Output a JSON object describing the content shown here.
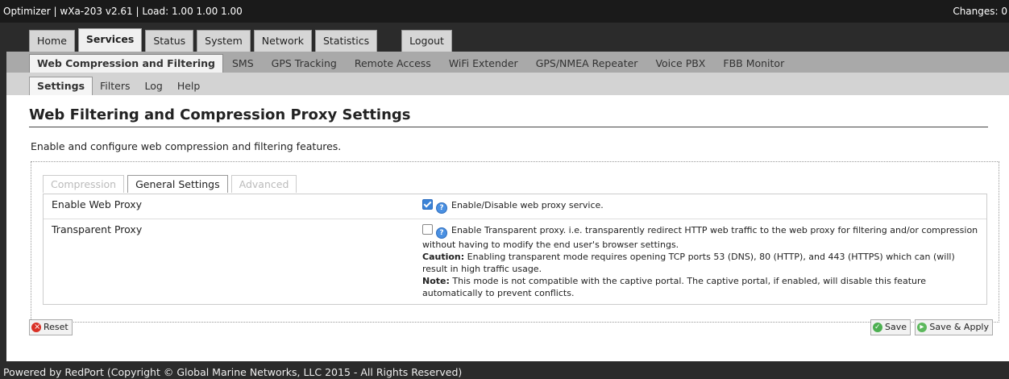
{
  "topbar": {
    "title": "Optimizer | wXa-203 v2.61 | Load: 1.00 1.00 1.00",
    "changes": "Changes: 0"
  },
  "nav1": [
    "Home",
    "Services",
    "Status",
    "System",
    "Network",
    "Statistics",
    "Logout"
  ],
  "nav1_active": "Services",
  "nav2": [
    "Web Compression and Filtering",
    "SMS",
    "GPS Tracking",
    "Remote Access",
    "WiFi Extender",
    "GPS/NMEA Repeater",
    "Voice PBX",
    "FBB Monitor"
  ],
  "nav3": [
    "Settings",
    "Filters",
    "Log",
    "Help"
  ],
  "page": {
    "title": "Web Filtering and Compression Proxy Settings",
    "description": "Enable and configure web compression and filtering features."
  },
  "section_tabs": [
    "Compression",
    "General Settings",
    "Advanced"
  ],
  "rows": {
    "web_proxy": {
      "label": "Enable Web Proxy",
      "checked": true,
      "text": "Enable/Disable web proxy service."
    },
    "transparent": {
      "label": "Transparent Proxy",
      "checked": false,
      "text": "Enable Transparent proxy. i.e. transparently redirect HTTP web traffic to the web proxy for filtering and/or compression without having to modify the end user's browser settings.",
      "caution_label": "Caution:",
      "caution_text": " Enabling transparent mode requires opening TCP ports 53 (DNS), 80 (HTTP), and 443 (HTTPS) which can (will) result in high traffic usage.",
      "note_label": "Note:",
      "note_text": " This mode is not compatible with the captive portal. The captive portal, if enabled, will disable this feature automatically to prevent conflicts."
    }
  },
  "buttons": {
    "reset": "Reset",
    "save": "Save",
    "save_apply": "Save & Apply"
  },
  "footer": "Powered by RedPort (Copyright © Global Marine Networks, LLC 2015 - All Rights Reserved)"
}
